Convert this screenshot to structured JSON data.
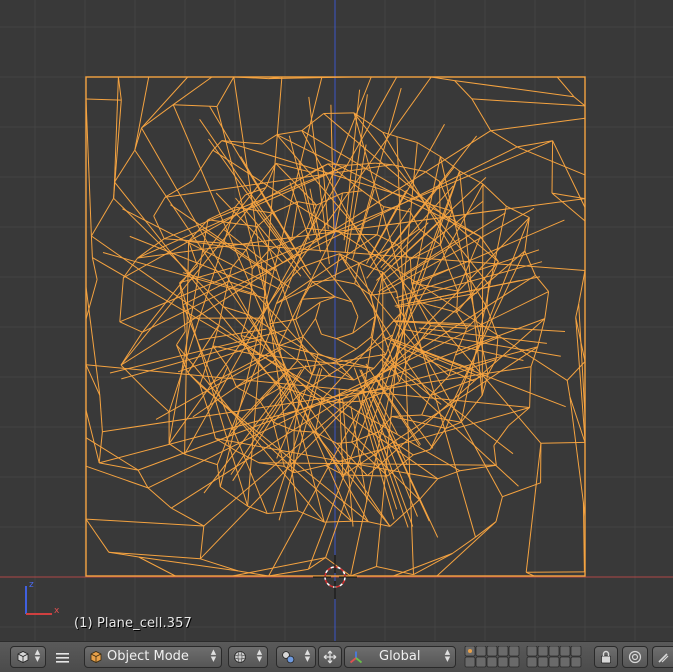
{
  "viewport": {
    "object_label": "(1) Plane_cell.357",
    "axis_labels": {
      "z": "z",
      "x": "x"
    },
    "colors": {
      "background": "#393939",
      "grid_line": "#444444",
      "wireframe": "#f5a340",
      "x_axis": "#b04848",
      "y_axis": "#3a55c8",
      "gizmo_x": "#d04040",
      "gizmo_z": "#4060e0"
    }
  },
  "header": {
    "editor_type_icon": "cube-view-icon",
    "menu_icon": "hamburger-menu-icon",
    "mode": {
      "label": "Object Mode",
      "icon": "object-cube-icon"
    },
    "viewport_shading_icon": "sphere-solid-icon",
    "pivot_icon": "pivot-point-icon",
    "manipulator_icon": "manipulator-arrows-icon",
    "orientation": {
      "label": "Global",
      "icon": "transform-axes-icon"
    },
    "layers_icon": "layer-grid-icon",
    "lock_icon": "lock-camera-icon",
    "snap_icon": "snap-magnet-icon",
    "proportional_icon": "proportional-edit-icon"
  }
}
